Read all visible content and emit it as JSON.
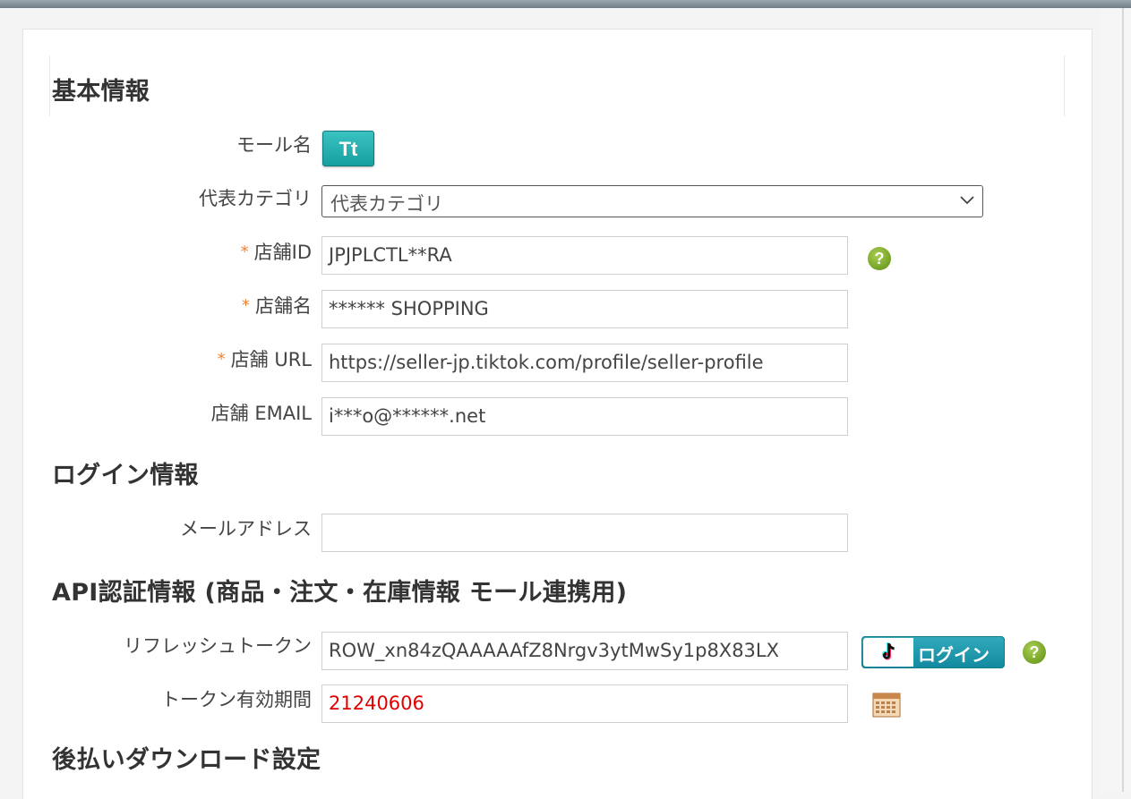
{
  "sections": {
    "basic": "基本情報",
    "login": "ログイン情報",
    "api": "API認証情報 (商品・注文・在庫情報 モール連携用)",
    "deferred": "後払いダウンロード設定"
  },
  "mall": {
    "label": "モール名",
    "badge": "Tt",
    "badge_color": "#1fa9a8"
  },
  "category": {
    "label": "代表カテゴリ",
    "selected": "代表カテゴリ"
  },
  "store_id": {
    "required_mark": "*",
    "label": "店舗ID",
    "value": "JPJPLCTL**RA"
  },
  "store_name": {
    "required_mark": "*",
    "label": "店舗名",
    "value": "****** SHOPPING"
  },
  "store_url": {
    "required_mark": "*",
    "label": "店舗 URL",
    "value": "https://seller-jp.tiktok.com/profile/seller-profile"
  },
  "store_email": {
    "label": "店舗 EMAIL",
    "value": "i***o@******.net"
  },
  "login": {
    "email_label": "メールアドレス",
    "email_value": ""
  },
  "api": {
    "refresh_label": "リフレッシュトークン",
    "refresh_value": "ROW_xn84zQAAAAAfZ8Nrgv3ytMwSy1p8X83LX",
    "login_button": "ログイン",
    "expiry_label": "トークン有効期間",
    "expiry_value": "21240606"
  },
  "icons": {
    "help": "?",
    "help_color": "#6b9a1f",
    "expiry_color": "#e00000"
  }
}
